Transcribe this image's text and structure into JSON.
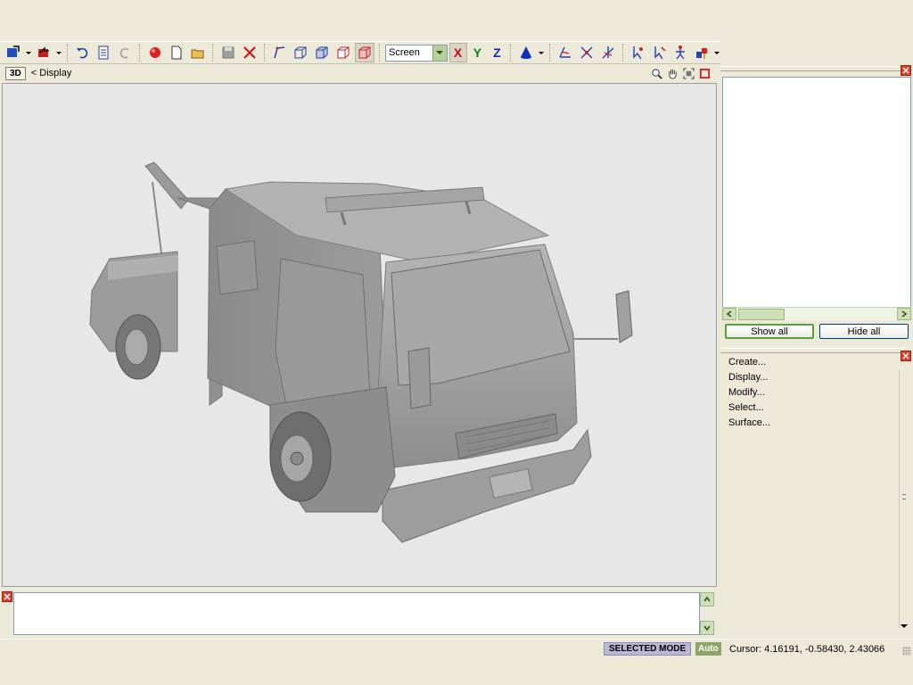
{
  "toolbar": {
    "view_mode_value": "Screen",
    "axis_x": "X",
    "axis_y": "Y",
    "axis_z": "Z"
  },
  "viewport": {
    "badge": "3D",
    "breadcrumb": "< Display",
    "background": "#e7e7e7",
    "model": "tow-truck-3d-model"
  },
  "objects_panel": {
    "show_all_label": "Show all",
    "hide_all_label": "Hide all"
  },
  "commands_panel": {
    "items": [
      "Create...",
      "Display...",
      "Modify...",
      "Select...",
      "Surface..."
    ]
  },
  "statusbar": {
    "mode": "SELECTED MODE",
    "auto": "Auto",
    "cursor": "Cursor: 4.16191, -0.58430, 2.43066"
  },
  "colors": {
    "chrome": "#ece9d8",
    "accent_green": "#8da568",
    "mode_badge": "#b9b7d6",
    "close_red": "#d94030"
  }
}
